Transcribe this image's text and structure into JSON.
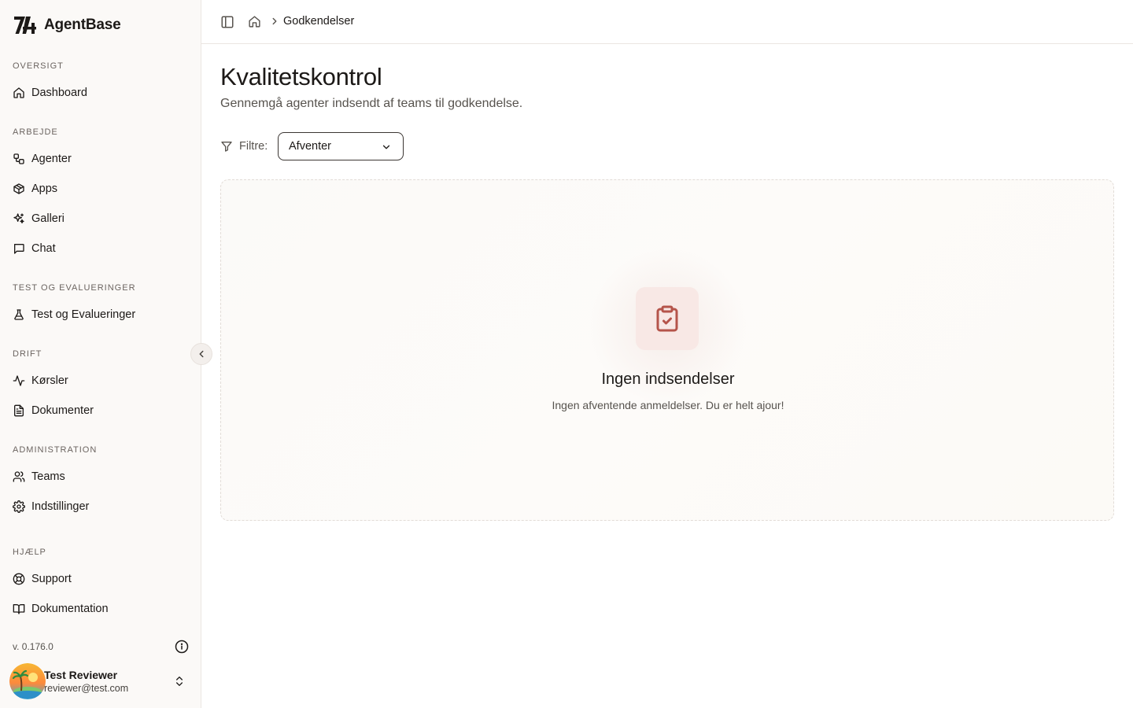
{
  "app": {
    "name": "AgentBase"
  },
  "sidebar": {
    "sections": [
      {
        "label": "OVERSIGT",
        "items": [
          {
            "label": "Dashboard",
            "icon": "home-icon"
          }
        ]
      },
      {
        "label": "ARBEJDE",
        "items": [
          {
            "label": "Agenter",
            "icon": "workflow-icon"
          },
          {
            "label": "Apps",
            "icon": "box-icon"
          },
          {
            "label": "Galleri",
            "icon": "sparkles-icon"
          },
          {
            "label": "Chat",
            "icon": "chat-bubble-icon"
          }
        ]
      },
      {
        "label": "TEST OG EVALUERINGER",
        "items": [
          {
            "label": "Test og Evalueringer",
            "icon": "flask-icon"
          }
        ]
      },
      {
        "label": "DRIFT",
        "items": [
          {
            "label": "Kørsler",
            "icon": "activity-icon"
          },
          {
            "label": "Dokumenter",
            "icon": "document-icon"
          }
        ]
      },
      {
        "label": "ADMINISTRATION",
        "items": [
          {
            "label": "Teams",
            "icon": "users-icon"
          },
          {
            "label": "Indstillinger",
            "icon": "gear-icon"
          }
        ]
      },
      {
        "label": "HJÆLP",
        "items": [
          {
            "label": "Support",
            "icon": "lifebuoy-icon"
          },
          {
            "label": "Dokumentation",
            "icon": "book-icon"
          }
        ]
      }
    ],
    "version": "v. 0.176.0",
    "user": {
      "name": "Test Reviewer",
      "email": "reviewer@test.com"
    }
  },
  "breadcrumb": {
    "current": "Godkendelser"
  },
  "page": {
    "title": "Kvalitetskontrol",
    "subtitle": "Gennemgå agenter indsendt af teams til godkendelse."
  },
  "filter": {
    "label": "Filtre:",
    "selected": "Afventer"
  },
  "empty_state": {
    "title": "Ingen indsendelser",
    "text": "Ingen afventende anmeldelser. Du er helt ajour!"
  },
  "colors": {
    "accent": "#b5544a",
    "icon_bg": "#f8e8e5",
    "sidebar_bg": "#fbf9f7"
  }
}
